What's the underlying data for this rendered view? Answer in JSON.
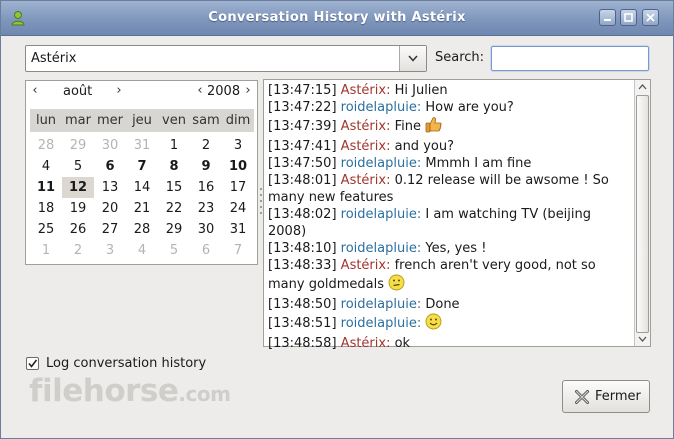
{
  "window": {
    "title": "Conversation History with Astérix"
  },
  "contact_combo": {
    "value": "Astérix"
  },
  "search": {
    "label": "Search:",
    "value": ""
  },
  "calendar": {
    "month": "août",
    "year": "2008",
    "prev_month": "‹",
    "next_month": "›",
    "prev_year": "‹",
    "next_year": "›",
    "day_names": [
      "lun",
      "mar",
      "mer",
      "jeu",
      "ven",
      "sam",
      "dim"
    ],
    "weeks": [
      [
        "28",
        "29",
        "30",
        "31",
        "1",
        "2",
        "3"
      ],
      [
        "4",
        "5",
        "6",
        "7",
        "8",
        "9",
        "10"
      ],
      [
        "11",
        "12",
        "13",
        "14",
        "15",
        "16",
        "17"
      ],
      [
        "18",
        "19",
        "20",
        "21",
        "22",
        "23",
        "24"
      ],
      [
        "25",
        "26",
        "27",
        "28",
        "29",
        "30",
        "31"
      ],
      [
        "1",
        "2",
        "3",
        "4",
        "5",
        "6",
        "7"
      ]
    ],
    "selected_day": "12",
    "marked_days": [
      "6",
      "7",
      "8",
      "9",
      "10",
      "11",
      "12"
    ]
  },
  "history": {
    "messages": [
      {
        "time": "[13:47:15]",
        "nick": "Astérix:",
        "text": " Hi Julien"
      },
      {
        "time": "[13:47:22]",
        "nick": "roidelapluie:",
        "text": " How are you?"
      },
      {
        "time": "[13:47:39]",
        "nick": "Astérix:",
        "text": " Fine ",
        "icon": "thumbs-up-icon"
      },
      {
        "time": "[13:47:41]",
        "nick": "Astérix:",
        "text": " and you?"
      },
      {
        "time": "[13:47:50]",
        "nick": "roidelapluie:",
        "text": " Mmmh I am fine"
      },
      {
        "time": "[13:48:01]",
        "nick": "Astérix:",
        "text": " 0.12 release will be awsome ! So many new features"
      },
      {
        "time": "[13:48:02]",
        "nick": "roidelapluie:",
        "text": " I am watching TV (beijing 2008)"
      },
      {
        "time": "[13:48:10]",
        "nick": "roidelapluie:",
        "text": " Yes, yes !"
      },
      {
        "time": "[13:48:33]",
        "nick": "Astérix:",
        "text": " french aren't very good, not so many goldmedals ",
        "icon": "meh-smiley-icon"
      },
      {
        "time": "[13:48:50]",
        "nick": "roidelapluie:",
        "text": " Done"
      },
      {
        "time": "[13:48:51]",
        "nick": "roidelapluie:",
        "text": " ",
        "icon": "smile-smiley-icon"
      },
      {
        "time": "[13:48:58]",
        "nick": "Astérix:",
        "text": " ok"
      }
    ]
  },
  "log_history": {
    "label": "Log conversation history",
    "checked": true
  },
  "close_button": {
    "label": "Fermer"
  },
  "watermark": {
    "text": "filehorse",
    "suffix": ".com"
  },
  "colors": {
    "asterix": "#a1362e",
    "roidelapluie": "#2c6f9e",
    "titlebar": "#7f97bc"
  }
}
